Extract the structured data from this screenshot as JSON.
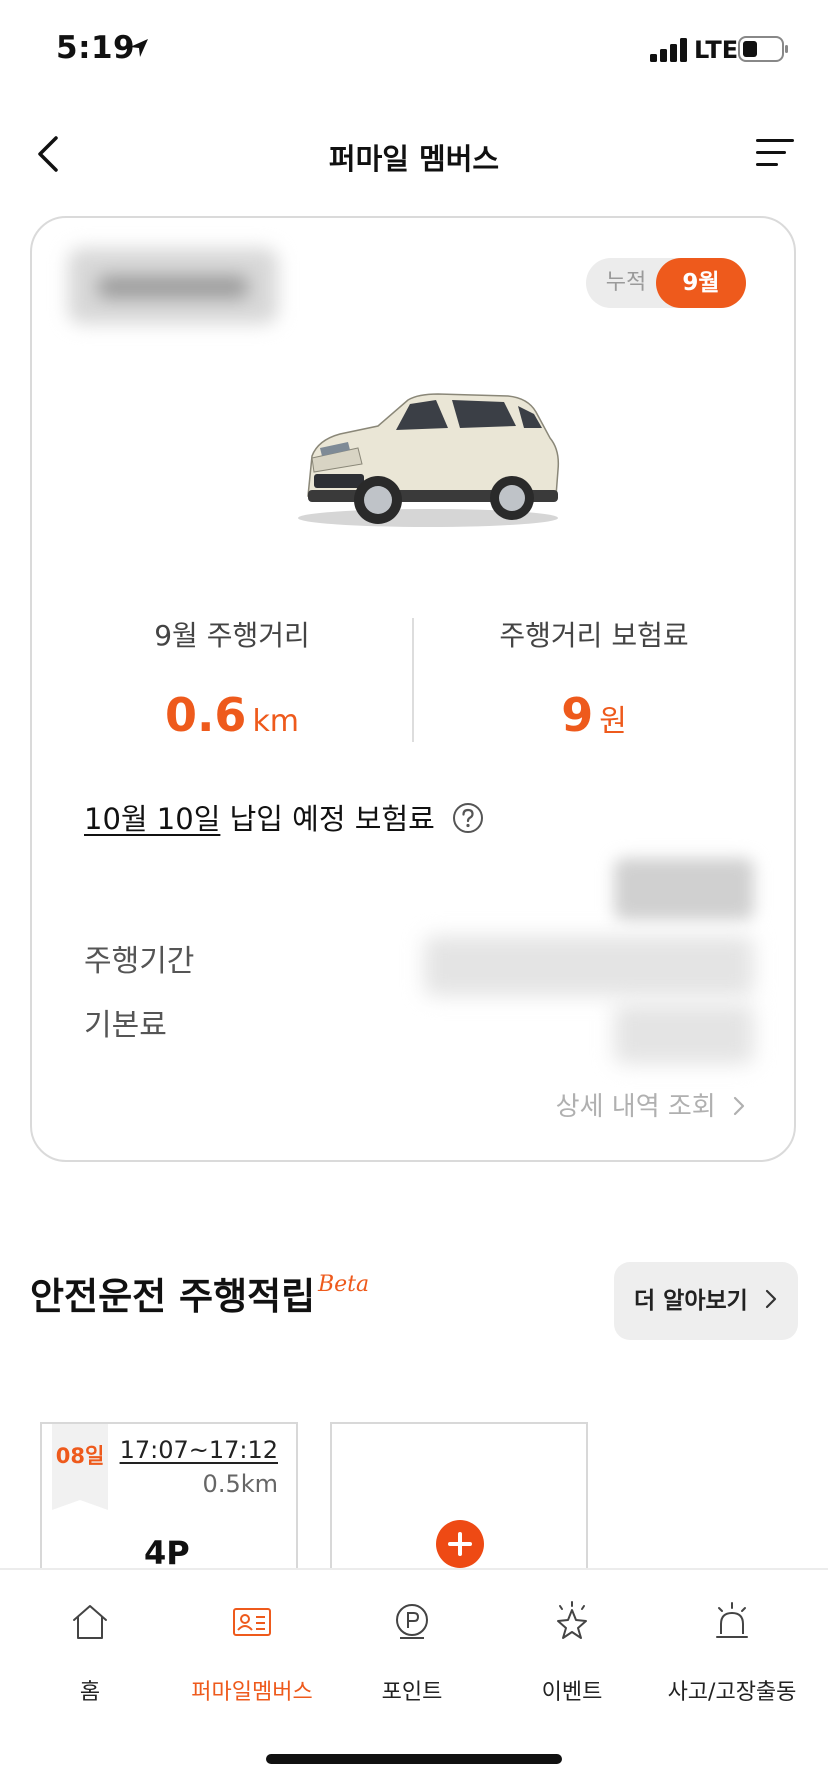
{
  "status_bar": {
    "time": "5:19",
    "network": "LTE"
  },
  "header": {
    "title": "퍼마일 멤버스"
  },
  "summary": {
    "toggle": {
      "cumulative": "누적",
      "month": "9월"
    },
    "distance_label": "9월 주행거리",
    "distance_value": "0.6",
    "distance_unit": "km",
    "premium_label": "주행거리 보험료",
    "premium_value": "9",
    "premium_unit": "원",
    "due_date": "10월 10일",
    "due_text": " 납입 예정 보험료",
    "rows": {
      "period_label": "주행기간",
      "basic_label": "기본료"
    },
    "detail_link": "상세 내역 조회"
  },
  "safe_driving": {
    "title": "안전운전 주행적립",
    "beta": "Beta",
    "learn_more": "더 알아보기",
    "trip": {
      "day": "08일",
      "time": "17:07~17:12",
      "distance": "0.5km",
      "points": "4P"
    }
  },
  "tabs": [
    {
      "label": "홈",
      "icon": "home-icon"
    },
    {
      "label": "퍼마일멤버스",
      "icon": "member-card-icon"
    },
    {
      "label": "포인트",
      "icon": "point-icon"
    },
    {
      "label": "이벤트",
      "icon": "star-icon"
    },
    {
      "label": "사고/고장출동",
      "icon": "siren-icon"
    }
  ],
  "colors": {
    "accent": "#ee5a1c",
    "border": "#dadada"
  }
}
